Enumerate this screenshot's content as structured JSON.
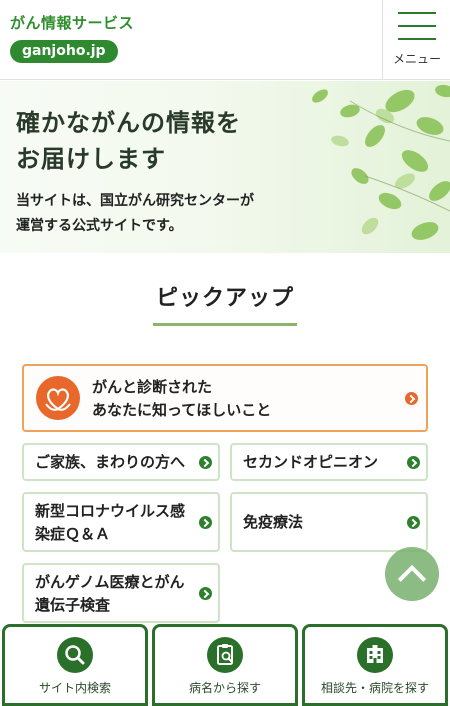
{
  "header": {
    "brand_name": "がん情報サービス",
    "brand_domain": "ganjoho.jp",
    "menu_label": "メニュー"
  },
  "hero": {
    "title_line1": "確かながんの情報を",
    "title_line2": "お届けします",
    "sub_line1": "当サイトは、国立がん研究センターが",
    "sub_line2": "運営する公式サイトです。"
  },
  "pickup": {
    "title": "ピックアップ",
    "main_card": {
      "line1": "がんと診断された",
      "line2": "あなたに知ってほしいこと"
    },
    "cards": [
      {
        "label": "ご家族、まわりの方へ"
      },
      {
        "label": "セカンドオピニオン"
      },
      {
        "line1": "新型コロナウイルス感",
        "line2": "染症Ｑ＆Ａ"
      },
      {
        "label": "免疫療法"
      },
      {
        "line1": "がんゲノム医療とがん",
        "line2": "遺伝子検査"
      }
    ]
  },
  "bottom_nav": [
    {
      "label": "サイト内検索",
      "icon": "search-icon"
    },
    {
      "label": "病名から探す",
      "icon": "clipboard-search-icon"
    },
    {
      "label": "相談先・病院を探す",
      "icon": "hospital-icon"
    }
  ],
  "colors": {
    "brand_green": "#2f8a2f",
    "nav_green": "#2c6e2c",
    "accent_orange": "#e8672a",
    "card_border": "#cfe3c6"
  }
}
